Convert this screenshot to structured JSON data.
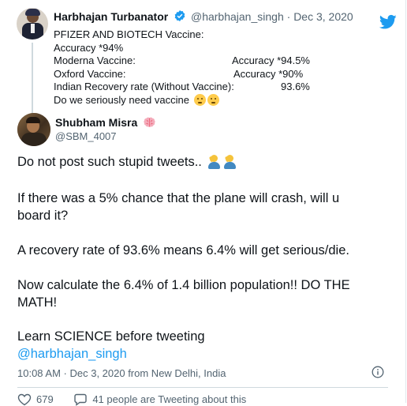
{
  "parent_tweet": {
    "author_name": "Harbhajan Turbanator",
    "author_handle": "@harbhajan_singh",
    "separator": "·",
    "date": "Dec 3, 2020",
    "lines": {
      "l1": "PFIZER AND BIOTECH Vaccine:",
      "l2": "Accuracy *94%",
      "l3_left": "Moderna Vaccine:",
      "l3_right": "Accuracy *94.5%",
      "l4_left": "Oxford Vaccine:",
      "l4_right": "Accuracy *90%",
      "l5_left": "Indian Recovery rate (Without Vaccine):",
      "l5_right": "93.6%",
      "l6": "Do we seriously need vaccine"
    },
    "emojis": [
      "thinking-face",
      "thinking-face"
    ]
  },
  "main_tweet": {
    "author_name": "Shubham Misra",
    "author_handle": "@SBM_4007",
    "paragraphs": {
      "p1": "Do not post such stupid tweets..",
      "p2_l1": "If there was a 5% chance that the plane will crash, will u",
      "p2_l2": "board it?",
      "p3": "A recovery rate of 93.6% means 6.4% will get serious/die.",
      "p4_l1": "Now calculate the 6.4% of 1.4 billion population!! DO THE",
      "p4_l2": "MATH!",
      "p5": "Learn SCIENCE before tweeting",
      "mention": "@harbhajan_singh"
    },
    "timestamp": "10:08 AM · Dec 3, 2020 from New Delhi, India",
    "like_count": "679",
    "talking_text": "41 people are Tweeting about this"
  },
  "colors": {
    "twitter_blue": "#1d9bf0",
    "secondary_text": "#536471",
    "primary_text": "#0f1419"
  },
  "icons": [
    "verified-badge-icon",
    "twitter-bird-icon",
    "brain-emoji-icon",
    "facepalm-emoji-icon",
    "info-icon",
    "heart-icon",
    "talking-icon"
  ]
}
